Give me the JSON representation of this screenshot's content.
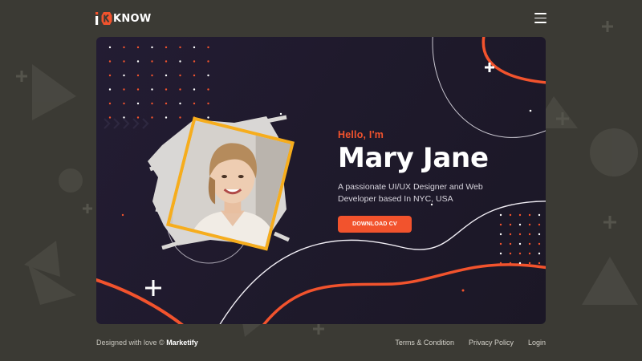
{
  "brand": {
    "logo_text": "KNOW",
    "logo_prefix": "i",
    "accent": "#f2532d",
    "frame": "#f6ad1d"
  },
  "header": {
    "menu_icon": "hamburger-menu-icon"
  },
  "hero": {
    "greeting": "Hello, I'm",
    "name": "Mary Jane",
    "tagline": "A passionate UI/UX Designer and Web Developer based In NYC, USA",
    "cta_label": "DOWNLOAD CV"
  },
  "footer": {
    "credit_prefix": "Designed with love © ",
    "credit_brand": "Marketify",
    "links": [
      "Terms & Condition",
      "Privacy Policy",
      "Login"
    ]
  },
  "colors": {
    "page_bg": "#3b3a34",
    "hero_bg": "#211b2e"
  }
}
